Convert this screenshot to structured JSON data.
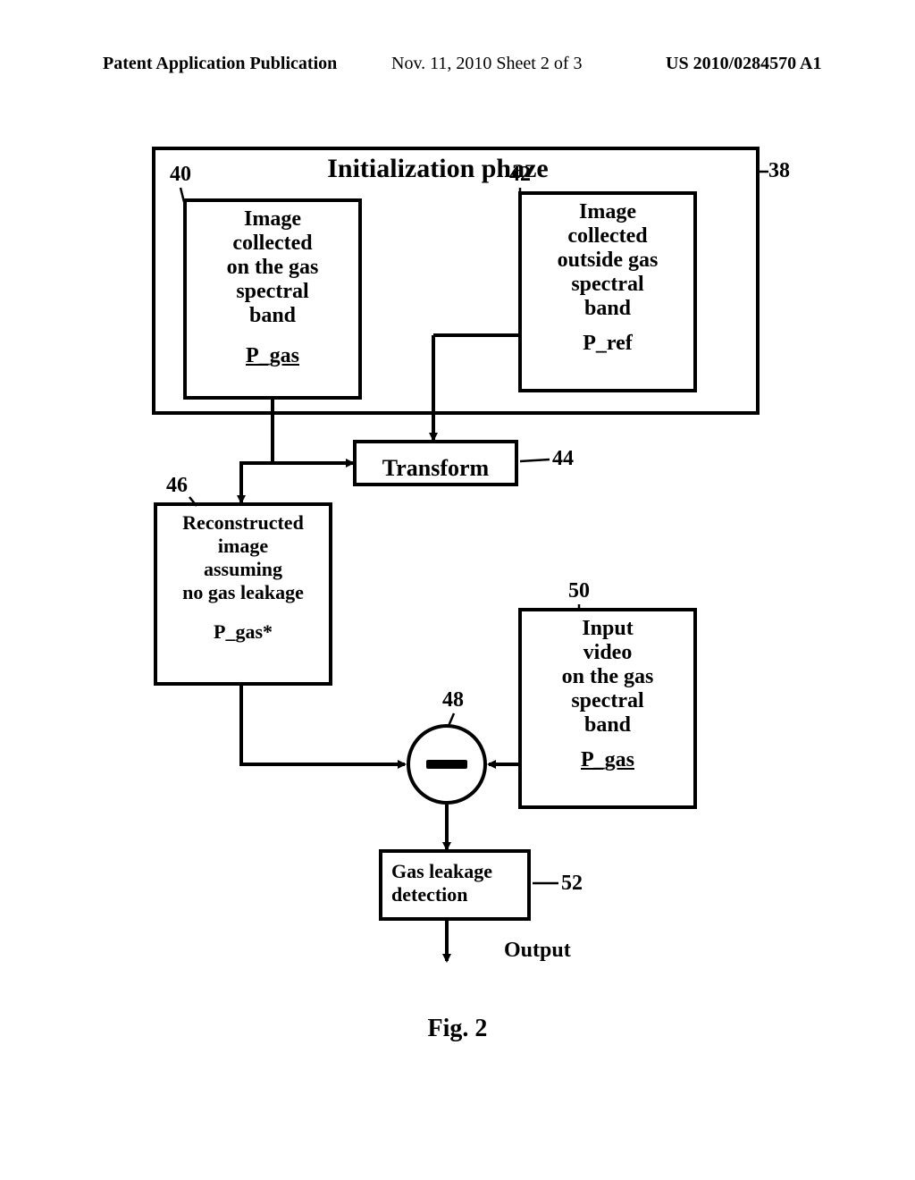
{
  "header": {
    "left": "Patent Application Publication",
    "center": "Nov. 11, 2010  Sheet 2 of 3",
    "right": "US 2010/0284570 A1"
  },
  "outer": {
    "title": "Initialization phaze",
    "ref_label": "38"
  },
  "boxes": {
    "b40": {
      "ref": "40",
      "line1": "Image",
      "line2": "collected",
      "line3": "on the gas",
      "line4": "spectral",
      "line5": "band",
      "var": "P_gas"
    },
    "b42": {
      "ref": "42",
      "line1": "Image",
      "line2": "collected",
      "line3": "outside gas",
      "line4": "spectral",
      "line5": "band",
      "var": "P_ref"
    },
    "b44": {
      "ref": "44",
      "text": "Transform"
    },
    "b46": {
      "ref": "46",
      "line1": "Reconstructed",
      "line2": "image",
      "line3": "assuming",
      "line4": "no gas leakage",
      "var": "P_gas*"
    },
    "b50": {
      "ref": "50",
      "line1": "Input",
      "line2": "video",
      "line3": "on the gas",
      "line4": "spectral",
      "line5": "band",
      "var": "P_gas"
    },
    "b48": {
      "ref": "48"
    },
    "b52": {
      "ref": "52",
      "line1": "Gas leakage",
      "line2": "detection"
    }
  },
  "output_label": "Output",
  "figure_caption": "Fig. 2"
}
